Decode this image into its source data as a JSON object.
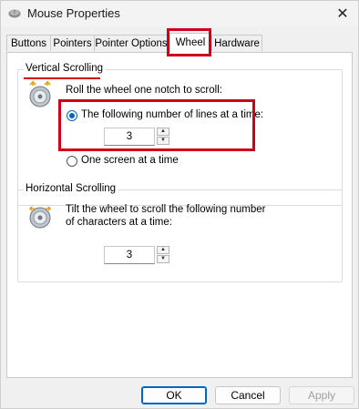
{
  "window": {
    "title": "Mouse Properties",
    "close_glyph": "✕"
  },
  "tabs": [
    {
      "label": "Buttons",
      "active": false
    },
    {
      "label": "Pointers",
      "active": false
    },
    {
      "label": "Pointer Options",
      "active": false
    },
    {
      "label": "Wheel",
      "active": true
    },
    {
      "label": "Hardware",
      "active": false
    }
  ],
  "vertical": {
    "group_label": "Vertical Scrolling",
    "instruction": "Roll the wheel one notch to scroll:",
    "option_lines": "The following number of lines at a time:",
    "lines_value": "3",
    "option_screen": "One screen at a time",
    "selected": "lines"
  },
  "horizontal": {
    "group_label": "Horizontal Scrolling",
    "instruction_line1": "Tilt the wheel to scroll the following number",
    "instruction_line2": "of characters at a time:",
    "chars_value": "3"
  },
  "buttons": {
    "ok": "OK",
    "cancel": "Cancel",
    "apply": "Apply"
  },
  "colors": {
    "highlight": "#d0021b",
    "accent": "#0067c0"
  }
}
